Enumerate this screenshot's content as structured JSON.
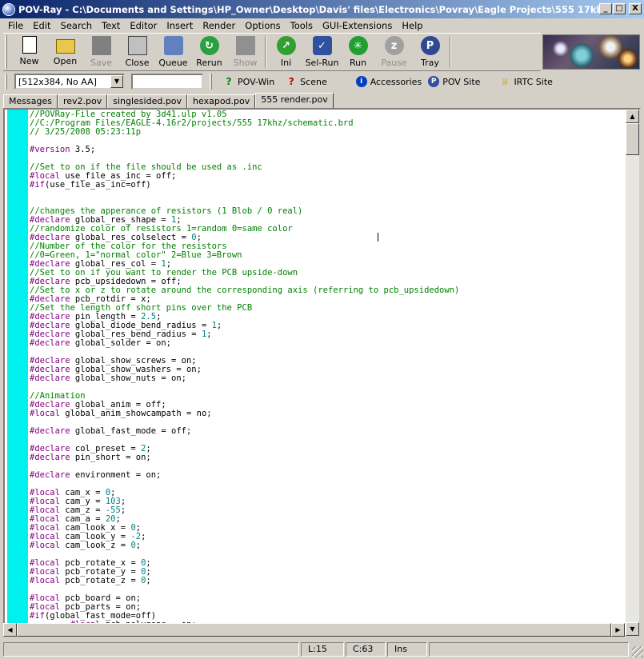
{
  "window": {
    "title": "POV-Ray - C:\\Documents and Settings\\HP_Owner\\Desktop\\Davis' files\\Electronics\\Povray\\Eagle Projects\\555 17khz\\555 ren...",
    "minimize": "_",
    "maximize": "□",
    "close": "X"
  },
  "menu": [
    "File",
    "Edit",
    "Search",
    "Text",
    "Editor",
    "Insert",
    "Render",
    "Options",
    "Tools",
    "GUI-Extensions",
    "Help"
  ],
  "toolbar": {
    "buttons": [
      {
        "label": "New",
        "icon": "new-file-icon",
        "enabled": true,
        "color": "#ffffff"
      },
      {
        "label": "Open",
        "icon": "open-folder-icon",
        "enabled": true,
        "color": "#e8c84a"
      },
      {
        "label": "Save",
        "icon": "save-disk-icon",
        "enabled": false,
        "color": "#808080"
      },
      {
        "label": "Close",
        "icon": "close-document-icon",
        "enabled": true,
        "color": "#c0c0c0"
      },
      {
        "label": "Queue",
        "icon": "queue-icon",
        "enabled": true,
        "color": "#6080c0"
      },
      {
        "label": "Rerun",
        "icon": "rerun-icon",
        "enabled": true,
        "color": "#2aa040"
      },
      {
        "label": "Show",
        "icon": "show-icon",
        "enabled": false,
        "color": "#909090"
      },
      {
        "label": "Ini",
        "icon": "ini-icon",
        "enabled": true,
        "color": "#30a030"
      },
      {
        "label": "Sel-Run",
        "icon": "sel-run-icon",
        "enabled": true,
        "color": "#3050a0"
      },
      {
        "label": "Run",
        "icon": "run-icon",
        "enabled": true,
        "color": "#20a030"
      },
      {
        "label": "Pause",
        "icon": "pause-icon",
        "enabled": false,
        "color": "#a0a0a0"
      },
      {
        "label": "Tray",
        "icon": "tray-icon",
        "enabled": true,
        "color": "#304890"
      }
    ]
  },
  "toolbar2": {
    "resolution": "[512x384, No AA]",
    "input_value": "",
    "links": [
      {
        "label": "POV-Win",
        "icon": "help-question-icon",
        "color": "#008000"
      },
      {
        "label": "Scene",
        "icon": "help-question-icon",
        "color": "#c00000"
      },
      {
        "label": "Accessories",
        "icon": "info-icon",
        "color": "#0040c0"
      },
      {
        "label": "POV Site",
        "icon": "pov-site-icon",
        "color": "#3050a0"
      },
      {
        "label": "IRTC Site",
        "icon": "trophy-icon",
        "color": "#c0a000"
      }
    ]
  },
  "tabs": [
    "Messages",
    "rev2.pov",
    "singlesided.pov",
    "hexapod.pov",
    "555 render.pov"
  ],
  "active_tab": 4,
  "code_lines": [
    "//POVRay-File created by 3d41.ulp v1.05",
    "//C:/Program Files/EAGLE-4.16r2/projects/555 17khz/schematic.brd",
    "// 3/25/2008 05:23:11p",
    "",
    "#version 3.5;",
    "",
    "//Set to on if the file should be used as .inc",
    "#local use_file_as_inc = off;",
    "#if(use_file_as_inc=off)",
    "",
    "",
    "//changes the apperance of resistors (1 Blob / 0 real)",
    "#declare global_res_shape = 1;",
    "//randomize color of resistors 1=random 0=same color",
    "#declare global_res_colselect = 0;",
    "//Number of the color for the resistors",
    "//0=Green, 1=\"normal color\" 2=Blue 3=Brown",
    "#declare global_res_col = 1;",
    "//Set to on if you want to render the PCB upside-down",
    "#declare pcb_upsidedown = off;",
    "//Set to x or z to rotate around the corresponding axis (referring to pcb_upsidedown)",
    "#declare pcb_rotdir = x;",
    "//Set the length off short pins over the PCB",
    "#declare pin_length = 2.5;",
    "#declare global_diode_bend_radius = 1;",
    "#declare global_res_bend_radius = 1;",
    "#declare global_solder = on;",
    "",
    "#declare global_show_screws = on;",
    "#declare global_show_washers = on;",
    "#declare global_show_nuts = on;",
    "",
    "//Animation",
    "#declare global_anim = off;",
    "#local global_anim_showcampath = no;",
    "",
    "#declare global_fast_mode = off;",
    "",
    "#declare col_preset = 2;",
    "#declare pin_short = on;",
    "",
    "#declare environment = on;",
    "",
    "#local cam_x = 0;",
    "#local cam_y = 103;",
    "#local cam_z = -55;",
    "#local cam_a = 20;",
    "#local cam_look_x = 0;",
    "#local cam_look_y = -2;",
    "#local cam_look_z = 0;",
    "",
    "#local pcb_rotate_x = 0;",
    "#local pcb_rotate_y = 0;",
    "#local pcb_rotate_z = 0;",
    "",
    "#local pcb_board = on;",
    "#local pcb_parts = on;",
    "#if(global_fast_mode=off)",
    "        #local pcb_polygons = on;"
  ],
  "status": {
    "line": "L:15",
    "col": "C:63",
    "mode": "Ins"
  },
  "colors": {
    "gutter": "#00f0f0",
    "comment": "#008000",
    "keyword": "#800080",
    "number": "#008080"
  }
}
